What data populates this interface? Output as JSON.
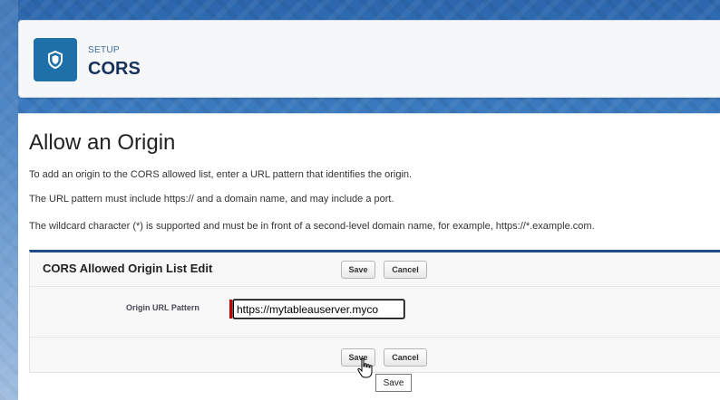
{
  "header": {
    "section_label": "SETUP",
    "title": "CORS",
    "icon": "shield-icon"
  },
  "main": {
    "heading": "Allow an Origin",
    "descriptions": [
      "To add an origin to the CORS allowed list, enter a URL pattern that identifies the origin.",
      "The URL pattern must include https:// and a domain name, and may include a port.",
      "The wildcard character (*) is supported and must be in front of a second-level domain name, for example, https://*.example.com."
    ]
  },
  "edit_block": {
    "title": "CORS Allowed Origin List Edit",
    "save_label": "Save",
    "cancel_label": "Cancel",
    "field_label": "Origin URL Pattern",
    "field_value": "https://mytableauserver.myco"
  },
  "tooltip": {
    "text": "Save"
  },
  "colors": {
    "brand_blue": "#1f6fa8",
    "title_navy": "#16325c",
    "required_red": "#c00000",
    "block_accent": "#1f4f86"
  }
}
